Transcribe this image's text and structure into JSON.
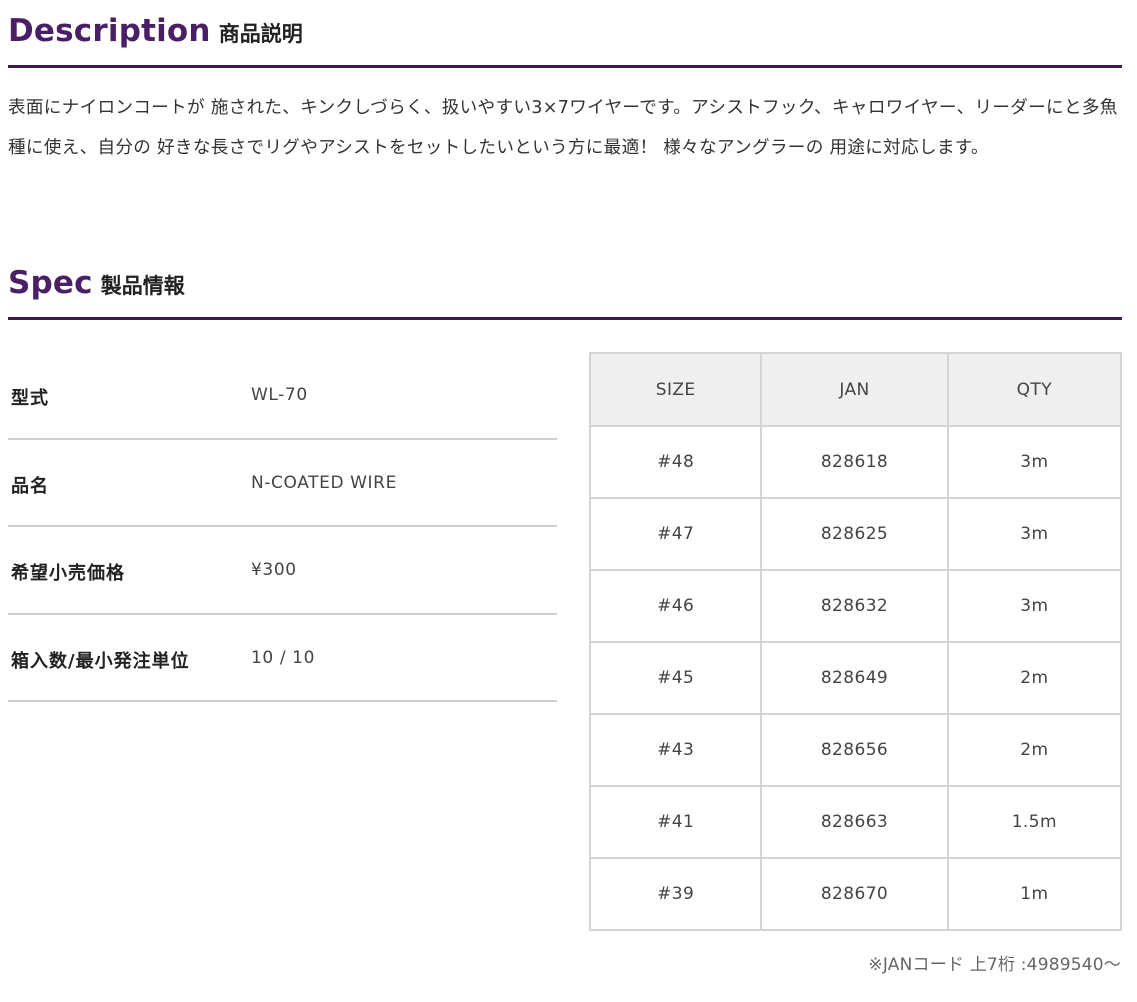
{
  "description": {
    "title_en": "Description",
    "title_jp": "商品説明",
    "text": "表面にナイロンコートが 施された、キンクしづらく、扱いやすい3×7ワイヤーです。アシストフック、キャロワイヤー、リーダーにと多魚種に使え、自分の 好きな長さでリグやアシストをセットしたいという方に最適！ 様々なアングラーの 用途に対応します。"
  },
  "spec": {
    "title_en": "Spec",
    "title_jp": "製品情報",
    "rows": [
      {
        "label": "型式",
        "value": "WL-70"
      },
      {
        "label": "品名",
        "value": "N-COATED WIRE"
      },
      {
        "label": "希望小売価格",
        "value": "¥300"
      },
      {
        "label": "箱入数/最小発注単位",
        "value": "10 / 10"
      }
    ]
  },
  "size_table": {
    "headers": [
      "SIZE",
      "JAN",
      "QTY"
    ],
    "rows": [
      [
        "#48",
        "828618",
        "3m"
      ],
      [
        "#47",
        "828625",
        "3m"
      ],
      [
        "#46",
        "828632",
        "3m"
      ],
      [
        "#45",
        "828649",
        "2m"
      ],
      [
        "#43",
        "828656",
        "2m"
      ],
      [
        "#41",
        "828663",
        "1.5m"
      ],
      [
        "#39",
        "828670",
        "1m"
      ]
    ],
    "footnote": "※JANコード 上7桁 :4989540〜"
  },
  "colors": {
    "heading_accent": "#4a1f66",
    "rule": "#3b1a52",
    "table_header_bg": "#efefef",
    "border": "#d4d4d4"
  }
}
